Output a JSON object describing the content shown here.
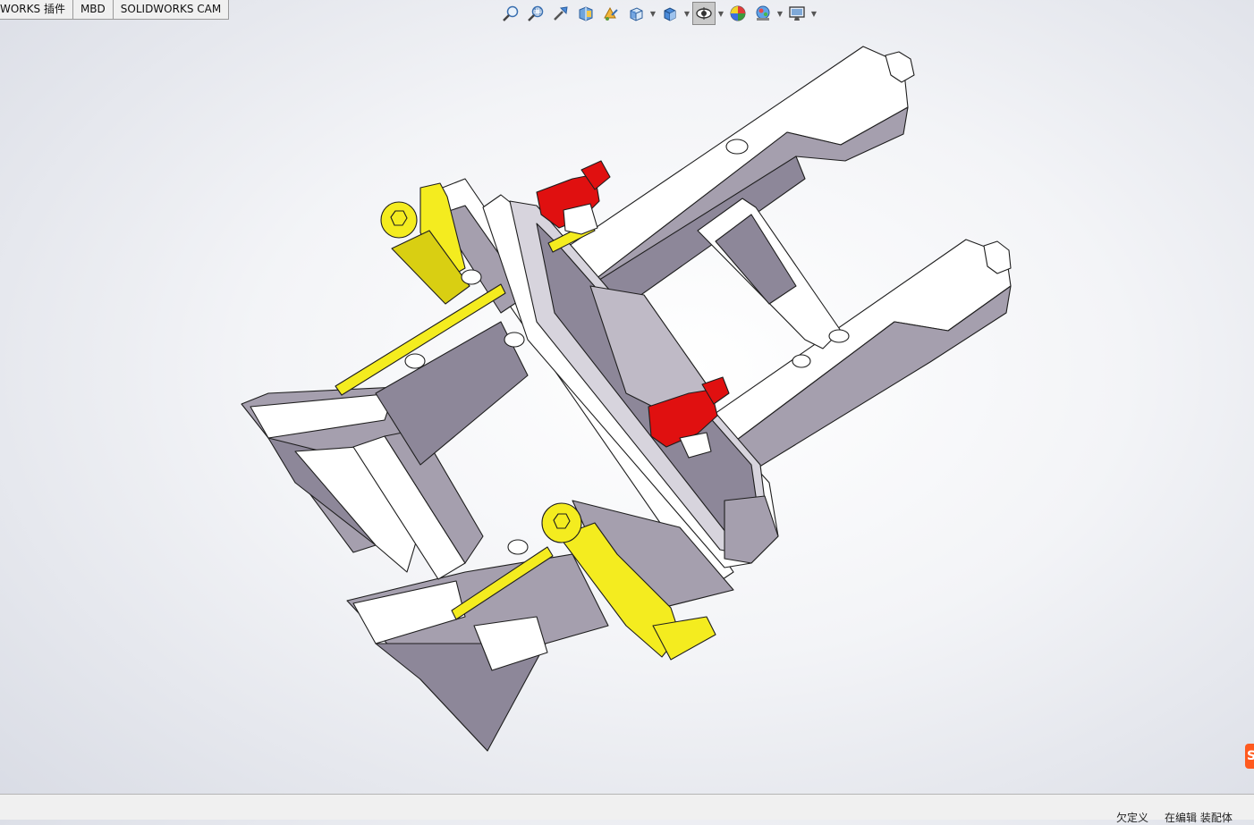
{
  "tabs": [
    {
      "label": "WORKS 插件"
    },
    {
      "label": "MBD"
    },
    {
      "label": "SOLIDWORKS CAM"
    }
  ],
  "toolbar": {
    "icons": [
      "zoom-to-fit-icon",
      "zoom-area-icon",
      "previous-view-icon",
      "section-view-icon",
      "dynamic-annotation-icon",
      "view-orientation-icon",
      "display-style-icon",
      "hide-show-icon",
      "edit-appearance-icon",
      "apply-scene-icon",
      "view-settings-icon"
    ]
  },
  "model": {
    "colors": {
      "frame_white": "#ffffff",
      "frame_gray": "#a59fae",
      "frame_dark": "#6e6878",
      "cylinder_yellow": "#f4ec1f",
      "motor_red": "#e01010",
      "edge": "#222222"
    }
  },
  "status": {
    "left": "欠定义",
    "right": "在编辑 装配体"
  },
  "taskpane": {
    "label": "S"
  }
}
